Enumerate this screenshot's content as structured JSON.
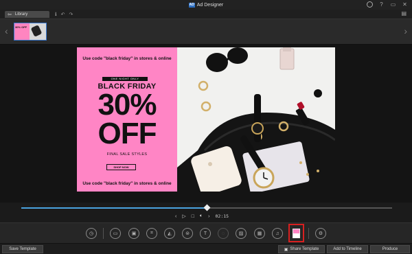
{
  "window": {
    "app_title": "Ad Designer",
    "logo_text": "AD",
    "controls": [
      "user-icon",
      "help-icon",
      "minimize-icon",
      "close-icon"
    ]
  },
  "tabbar": {
    "library_label": "Library",
    "tools": [
      "info-icon",
      "undo-icon",
      "redo-icon"
    ]
  },
  "filmstrip": {
    "thumbnail": {
      "text": "30% OFF",
      "accent": "#ff85c0"
    }
  },
  "ad": {
    "background": "#ff85c5",
    "top_code": "Use code \"black friday\" in stores & online",
    "one_night": "ONE NIGHT ONLY",
    "headline": "BLACK FRIDAY",
    "percent": "30%",
    "off": "OFF",
    "final_sale": "FINAL SALE STYLES",
    "shop_now": "SHOP NOW",
    "bottom_code": "Use code \"black friday\" in stores & online"
  },
  "timeline": {
    "progress": 0.5,
    "time": "02:15",
    "accent": "#4aa3e0"
  },
  "tools": [
    "clock-icon",
    "image-frame-icon",
    "background-icon",
    "crop-icon",
    "flip-icon",
    "layer-icon",
    "text-icon",
    "chat-icon",
    "photo-icon",
    "media-icon",
    "music-icon",
    "template-color-icon",
    "settings-icon"
  ],
  "bottom": {
    "save_template": "Save Template",
    "share_template": "Share Template",
    "add_to_timeline": "Add to Timeline",
    "produce": "Produce"
  }
}
